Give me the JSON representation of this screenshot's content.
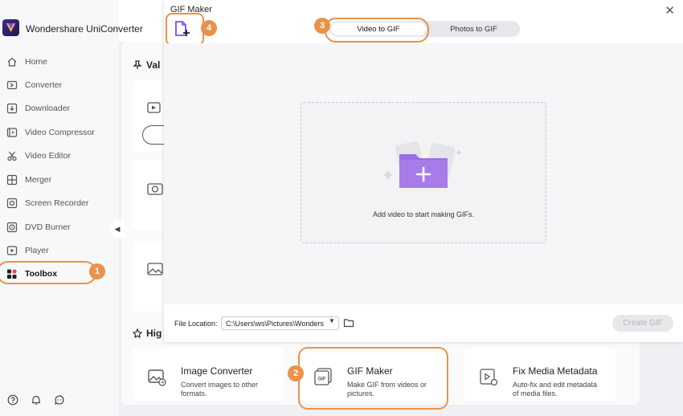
{
  "app": {
    "name": "Wondershare UniConverter"
  },
  "sidebar": {
    "items": [
      {
        "label": "Home",
        "icon": "home-icon"
      },
      {
        "label": "Converter",
        "icon": "converter-icon"
      },
      {
        "label": "Downloader",
        "icon": "downloader-icon"
      },
      {
        "label": "Video Compressor",
        "icon": "compressor-icon"
      },
      {
        "label": "Video Editor",
        "icon": "scissors-icon"
      },
      {
        "label": "Merger",
        "icon": "merger-icon"
      },
      {
        "label": "Screen Recorder",
        "icon": "screen-recorder-icon"
      },
      {
        "label": "DVD Burner",
        "icon": "dvd-icon"
      },
      {
        "label": "Player",
        "icon": "player-icon"
      },
      {
        "label": "Toolbox",
        "icon": "toolbox-icon",
        "active": true
      }
    ],
    "bottom_icons": [
      "help-icon",
      "bell-icon",
      "feedback-icon"
    ]
  },
  "background": {
    "section_top_heading": "Val",
    "section_bottom_heading": "Hig",
    "tools": [
      {
        "title": "Image Converter",
        "desc": "Convert images to other formats.",
        "icon": "image-converter-icon"
      },
      {
        "title": "GIF Maker",
        "desc": "Make GIF from videos or pictures.",
        "icon": "gif-icon"
      },
      {
        "title": "Fix Media Metadata",
        "desc": "Auto-fix and edit metadata of media files.",
        "icon": "metadata-icon"
      }
    ]
  },
  "dialog": {
    "title": "GIF Maker",
    "close_glyph": "✕",
    "tabs": [
      {
        "label": "Video to GIF",
        "active": true
      },
      {
        "label": "Photos to GIF",
        "active": false
      }
    ],
    "drop_text": "Add video to start making GIFs.",
    "file_location_label": "File Location:",
    "file_location_value": "C:\\Users\\ws\\Pictures\\Wonders",
    "create_button": "Create GIF"
  },
  "steps": [
    "1",
    "2",
    "3",
    "4"
  ],
  "colors": {
    "accent": "#e9924a",
    "folder": "#a77be8",
    "sidebar_bg": "#f7f8fa"
  }
}
